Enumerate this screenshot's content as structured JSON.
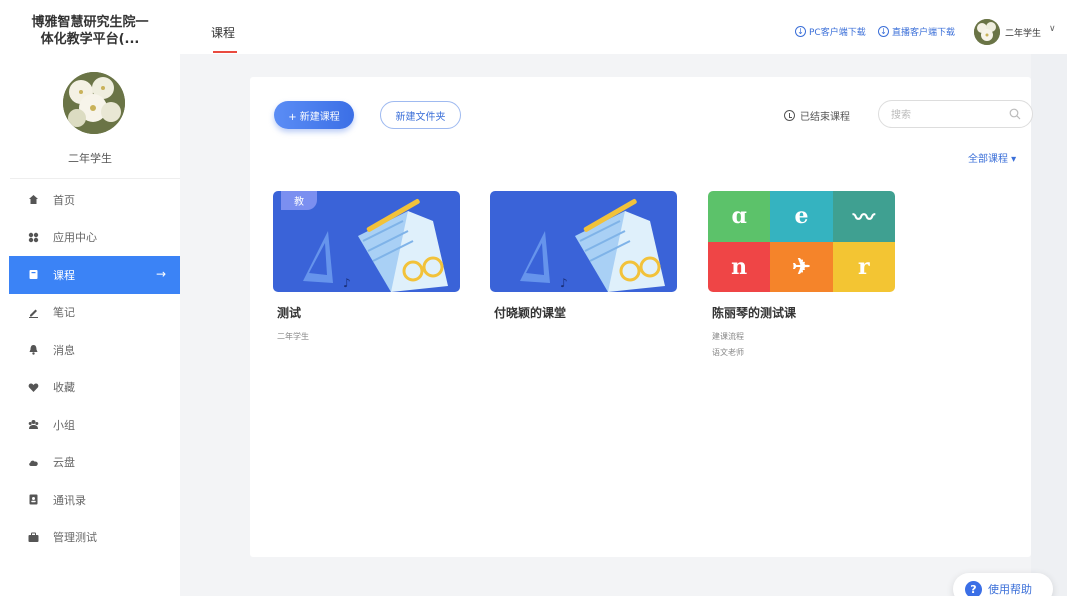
{
  "sidebar": {
    "brand_line1": "博雅智慧研究生院一",
    "brand_line2": "体化教学平台(...",
    "user_name": "二年学生",
    "items": [
      {
        "label": "首页",
        "icon": "home-icon"
      },
      {
        "label": "应用中心",
        "icon": "apps-icon"
      },
      {
        "label": "课程",
        "icon": "book-icon",
        "active": true
      },
      {
        "label": "笔记",
        "icon": "pen-icon"
      },
      {
        "label": "消息",
        "icon": "bell-icon"
      },
      {
        "label": "收藏",
        "icon": "heart-icon"
      },
      {
        "label": "小组",
        "icon": "group-icon"
      },
      {
        "label": "云盘",
        "icon": "cloud-icon"
      },
      {
        "label": "通讯录",
        "icon": "contacts-icon"
      },
      {
        "label": "管理测试",
        "icon": "briefcase-icon"
      }
    ],
    "active_arrow": "→"
  },
  "topbar": {
    "tab": "课程",
    "pc_download": "PC客户端下载",
    "live_download": "直播客户端下载",
    "user_name": "二年学生",
    "chevron": "∨"
  },
  "toolbar": {
    "new_course": "+ 新建课程",
    "new_folder": "新建文件夹",
    "ended_courses": "已结束课程",
    "search_placeholder": "搜索",
    "all_courses": "全部课程 ▾"
  },
  "courses": [
    {
      "title": "测试",
      "meta1": "二年学生",
      "meta2": "",
      "badge": "教"
    },
    {
      "title": "付晓颖的课堂",
      "meta1": "",
      "meta2": ""
    },
    {
      "title": "陈丽琴的测试课",
      "meta1": "建课流程",
      "meta2": "语文老师"
    }
  ],
  "help": {
    "label": "使用帮助",
    "icon": "?"
  }
}
